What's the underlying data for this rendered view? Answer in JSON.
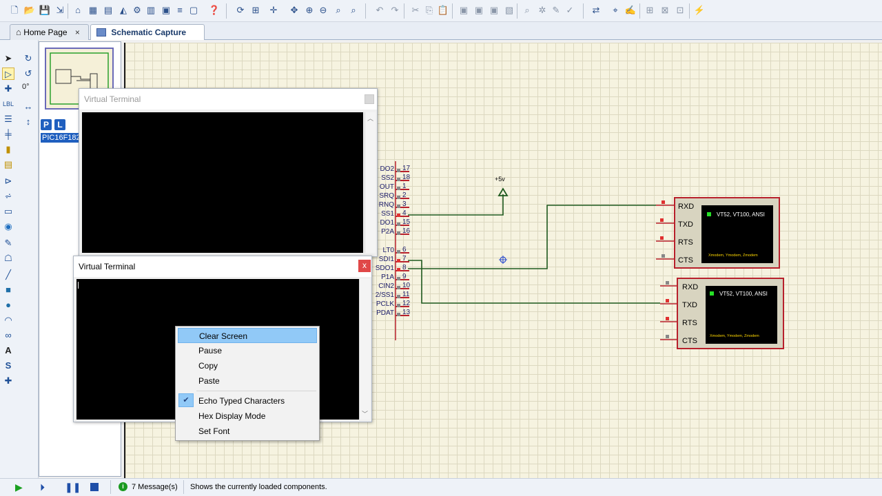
{
  "tabs": [
    {
      "label": "Home Page",
      "close": "×"
    },
    {
      "label": "Schematic Capture",
      "close": "×"
    }
  ],
  "left_tools": {
    "angle": "0°",
    "p_button": "P",
    "l_button": "L",
    "component": "PIC16F182"
  },
  "schematic": {
    "supply_label": "+5v",
    "mcu_pins_upper": [
      {
        "name": "DO2",
        "num": "17"
      },
      {
        "name": "SS2",
        "num": "18"
      },
      {
        "name": "OUT",
        "num": "1"
      },
      {
        "name": "SRQ",
        "num": "2"
      },
      {
        "name": "RNQ",
        "num": "3"
      },
      {
        "name": "SS1",
        "num": "4"
      },
      {
        "name": "DO1",
        "num": "15"
      },
      {
        "name": "P2A",
        "num": "16"
      }
    ],
    "mcu_pins_lower": [
      {
        "name": "LT0",
        "num": "6"
      },
      {
        "name": "SDI1",
        "num": "7"
      },
      {
        "name": "SDO1",
        "num": "8"
      },
      {
        "name": "P1A",
        "num": "9"
      },
      {
        "name": "CIN2",
        "num": "10"
      },
      {
        "name": "2/SS1",
        "num": "11"
      },
      {
        "name": "PCLK",
        "num": "12"
      },
      {
        "name": "PDAT",
        "num": "13"
      }
    ],
    "terminals": [
      {
        "signals": [
          "RXD",
          "TXD",
          "RTS",
          "CTS"
        ],
        "screen_text": "VT52, VT100, ANSI",
        "screen_sub": "Xmodem, Ymodem, Zmodem"
      },
      {
        "signals": [
          "RXD",
          "TXD",
          "RTS",
          "CTS"
        ],
        "screen_text": "VT52, VT100, ANSI",
        "screen_sub": "Xmodem, Ymodem, Zmodem"
      }
    ]
  },
  "terminal_windows": [
    {
      "title": "Virtual Terminal"
    },
    {
      "title": "Virtual Terminal",
      "close": "x"
    }
  ],
  "context_menu": {
    "items": [
      "Clear Screen",
      "Pause",
      "Copy",
      "Paste",
      "Echo Typed Characters",
      "Hex Display Mode",
      "Set Font"
    ],
    "highlighted": "Clear Screen",
    "checked": "Echo Typed Characters",
    "check_mark": "✔"
  },
  "status": {
    "messages": "7 Message(s)",
    "hint": "Shows the currently loaded components."
  },
  "colors": {
    "wire": "#1f5a1f",
    "component_outline": "#b8202b",
    "menu_highlight": "#91c9f7"
  }
}
